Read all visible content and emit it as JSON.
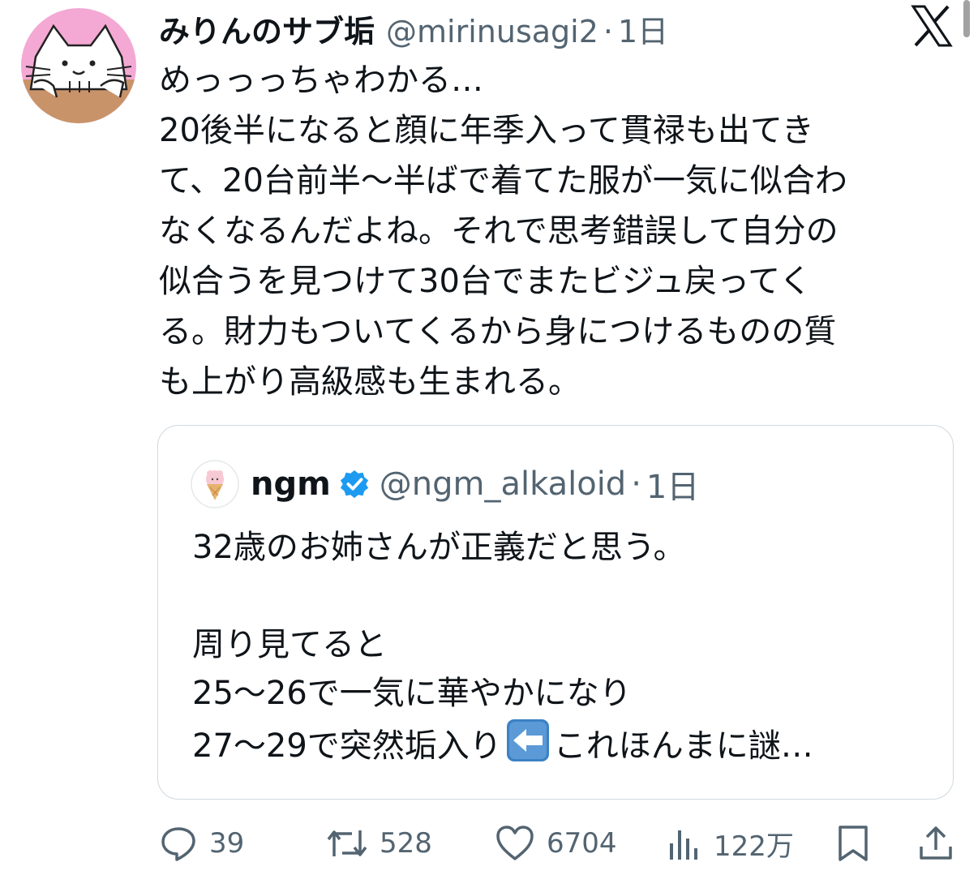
{
  "tweet": {
    "display_name": "みりんのサブ垢",
    "handle": "@mirinusagi2",
    "separator": "·",
    "time": "1日",
    "avatar_icon": "cat-avatar-icon",
    "text_lines": [
      "めっっっちゃわかる…",
      "20後半になると顔に年季入って貫禄も出てき",
      "て、20台前半〜半ばで着てた服が一気に似合わ",
      "なくなるんだよね。それで思考錯誤して自分の",
      "似合うを見つけて30台でまたビジュ戻ってく",
      "る。財力もついてくるから身につけるものの質",
      "も上がり高級感も生まれる。"
    ]
  },
  "quote": {
    "display_name": "ngm",
    "verified_icon": "verified-badge-icon",
    "handle": "@ngm_alkaloid",
    "separator": "·",
    "time": "1日",
    "avatar_icon": "ice-cream-avatar-icon",
    "line1": "32歳のお姉さんが正義だと思う。",
    "line2": "",
    "line3": "周り見てると",
    "line4": "25〜26で一気に華やかになり",
    "line5_before": "27〜29で突然垢入り",
    "line5_emoji": "left-arrow-emoji-icon",
    "line5_after": "これほんまに謎…"
  },
  "actions": {
    "reply_count": "39",
    "retweet_count": "528",
    "like_count": "6704",
    "views_count": "122万"
  },
  "colors": {
    "text": "#0f1419",
    "secondary": "#536471",
    "border": "#cfd9de",
    "verified": "#1d9bf0",
    "emoji_blue": "#3b82c4"
  }
}
